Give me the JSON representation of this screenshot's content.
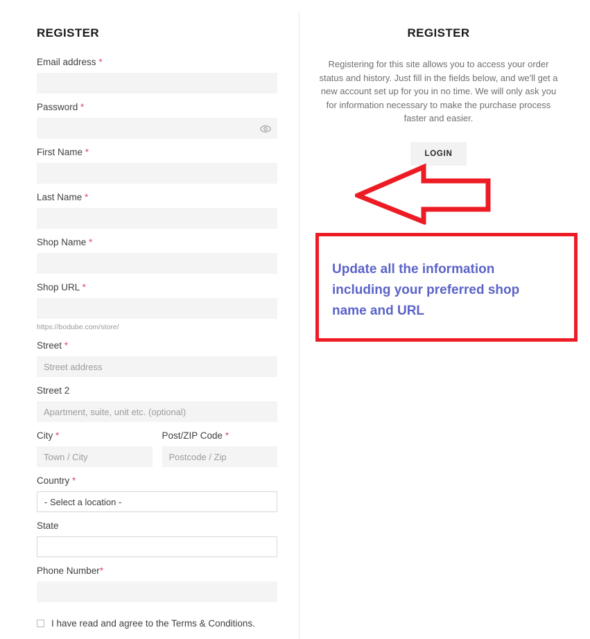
{
  "left": {
    "title": "REGISTER",
    "fields": [
      {
        "label": "Email address",
        "required": true,
        "placeholder": "",
        "value": "",
        "style": "filled"
      },
      {
        "label": "Password",
        "required": true,
        "placeholder": "",
        "value": "",
        "style": "filled",
        "icon": "eye-icon"
      },
      {
        "label": "First Name",
        "required": true,
        "placeholder": "",
        "value": "",
        "style": "filled"
      },
      {
        "label": "Last Name",
        "required": true,
        "placeholder": "",
        "value": "",
        "style": "filled"
      },
      {
        "label": "Shop Name",
        "required": true,
        "placeholder": "",
        "value": "",
        "style": "filled"
      },
      {
        "label": "Shop URL",
        "required": true,
        "placeholder": "",
        "value": "",
        "style": "filled",
        "help": "https://bodube.com/store/"
      },
      {
        "label": "Street",
        "required": true,
        "placeholder": "Street address",
        "value": "",
        "style": "filled"
      },
      {
        "label": "Street 2",
        "required": false,
        "placeholder": "Apartment, suite, unit etc. (optional)",
        "value": "",
        "style": "filled"
      },
      {
        "label": "City",
        "required": true,
        "placeholder": "Town / City",
        "value": "",
        "style": "filled"
      },
      {
        "label": "Post/ZIP Code",
        "required": true,
        "placeholder": "Postcode / Zip",
        "value": "",
        "style": "filled"
      },
      {
        "label": "Country",
        "required": true,
        "placeholder": "",
        "value": "- Select a location -",
        "style": "bordered"
      },
      {
        "label": "State",
        "required": false,
        "placeholder": "",
        "value": "",
        "style": "bordered"
      },
      {
        "label": "Phone Number",
        "required": true,
        "required_no_space": true,
        "placeholder": "",
        "value": "",
        "style": "filled"
      }
    ],
    "required_marker": "*",
    "terms_label": "I have read and agree to the Terms & Conditions.",
    "terms_checked": false
  },
  "right": {
    "title": "REGISTER",
    "description": "Registering for this site allows you to access your order status and history. Just fill in the fields below, and we'll get a new account set up for you in no time. We will only ask you for information necessary to make the purchase process faster and easier.",
    "login_label": "LOGIN"
  },
  "annotations": {
    "arrow": {
      "name": "left-pointing-arrow",
      "color": "#ed1c24"
    },
    "callout": {
      "text": "Update all the information including your preferred shop name and URL",
      "border_color": "#ed1c24",
      "text_color": "#5b63c8"
    }
  },
  "colors": {
    "required_asterisk": "#e2476a",
    "input_fill": "#f4f4f4",
    "annotation_red": "#ed1c24",
    "annotation_blue": "#5b63c8"
  }
}
